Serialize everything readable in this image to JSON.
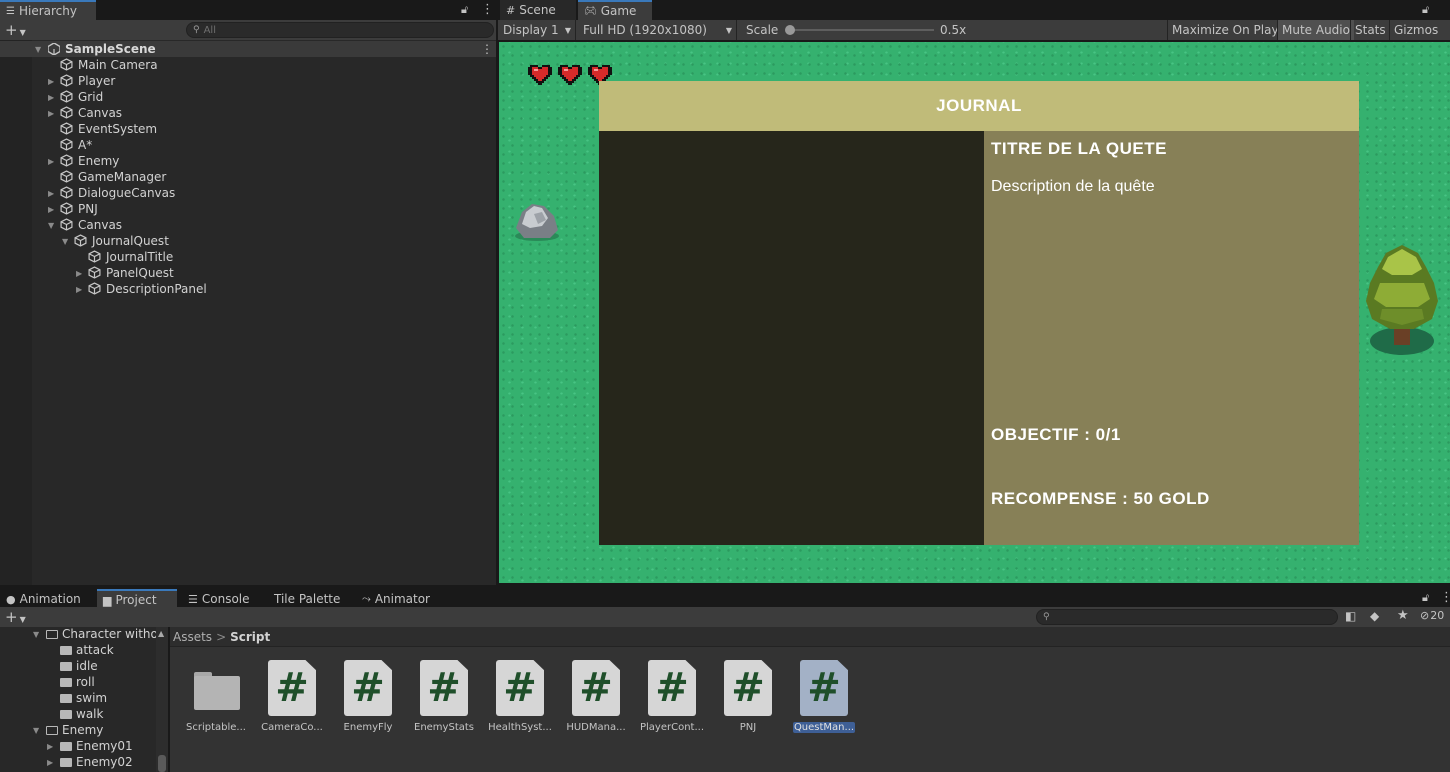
{
  "hierarchy": {
    "tab_label": "Hierarchy",
    "search_placeholder": "All",
    "scene_name": "SampleScene",
    "items": [
      {
        "label": "Main Camera",
        "depth": 1,
        "arrow": ""
      },
      {
        "label": "Player",
        "depth": 1,
        "arrow": "▶"
      },
      {
        "label": "Grid",
        "depth": 1,
        "arrow": "▶"
      },
      {
        "label": "Canvas",
        "depth": 1,
        "arrow": "▶"
      },
      {
        "label": "EventSystem",
        "depth": 1,
        "arrow": ""
      },
      {
        "label": "A*",
        "depth": 1,
        "arrow": ""
      },
      {
        "label": "Enemy",
        "depth": 1,
        "arrow": "▶"
      },
      {
        "label": "GameManager",
        "depth": 1,
        "arrow": ""
      },
      {
        "label": "DialogueCanvas",
        "depth": 1,
        "arrow": "▶"
      },
      {
        "label": "PNJ",
        "depth": 1,
        "arrow": "▶"
      },
      {
        "label": "Canvas",
        "depth": 1,
        "arrow": "▼"
      },
      {
        "label": "JournalQuest",
        "depth": 2,
        "arrow": "▼"
      },
      {
        "label": "JournalTitle",
        "depth": 3,
        "arrow": ""
      },
      {
        "label": "PanelQuest",
        "depth": 3,
        "arrow": "▶"
      },
      {
        "label": "DescriptionPanel",
        "depth": 3,
        "arrow": "▶"
      }
    ]
  },
  "view_tabs": {
    "scene": "Scene",
    "game": "Game"
  },
  "game_toolbar": {
    "display": "Display 1",
    "resolution": "Full HD (1920x1080)",
    "scale_label": "Scale",
    "scale_value": "0.5x",
    "maximize": "Maximize On Play",
    "mute": "Mute Audio",
    "stats": "Stats",
    "gizmos": "Gizmos"
  },
  "game": {
    "hearts": 3,
    "journal_title": "JOURNAL",
    "quest_title": "TITRE DE LA QUETE",
    "quest_description": "Description de la quête",
    "objective": "OBJECTIF : 0/1",
    "reward": "RECOMPENSE : 50 GOLD"
  },
  "bottom_tabs": {
    "animation": "Animation",
    "project": "Project",
    "console": "Console",
    "tile_palette": "Tile Palette",
    "animator": "Animator"
  },
  "project": {
    "tree": [
      {
        "label": "Character withou",
        "depth": 1,
        "arrow": "▼",
        "open": true
      },
      {
        "label": "attack",
        "depth": 2,
        "arrow": ""
      },
      {
        "label": "idle",
        "depth": 2,
        "arrow": ""
      },
      {
        "label": "roll",
        "depth": 2,
        "arrow": ""
      },
      {
        "label": "swim",
        "depth": 2,
        "arrow": ""
      },
      {
        "label": "walk",
        "depth": 2,
        "arrow": ""
      },
      {
        "label": "Enemy",
        "depth": 1,
        "arrow": "▼",
        "open": true
      },
      {
        "label": "Enemy01",
        "depth": 2,
        "arrow": "▶"
      },
      {
        "label": "Enemy02",
        "depth": 2,
        "arrow": "▶"
      }
    ],
    "breadcrumb_root": "Assets",
    "breadcrumb_current": "Script",
    "visible_count": "20",
    "assets": [
      {
        "label": "Scriptable...",
        "kind": "folder"
      },
      {
        "label": "CameraCo...",
        "kind": "script"
      },
      {
        "label": "EnemyFly",
        "kind": "script"
      },
      {
        "label": "EnemyStats",
        "kind": "script"
      },
      {
        "label": "HealthSyst...",
        "kind": "script"
      },
      {
        "label": "HUDMana...",
        "kind": "script"
      },
      {
        "label": "PlayerCont...",
        "kind": "script"
      },
      {
        "label": "PNJ",
        "kind": "script"
      },
      {
        "label": "QuestMan...",
        "kind": "script",
        "selected": true
      }
    ]
  },
  "colors": {
    "accent": "#3a79bb",
    "grass": "#35b16f",
    "journal_header": "#c0bb79",
    "quest_list": "#26261b",
    "quest_detail": "#878057"
  }
}
